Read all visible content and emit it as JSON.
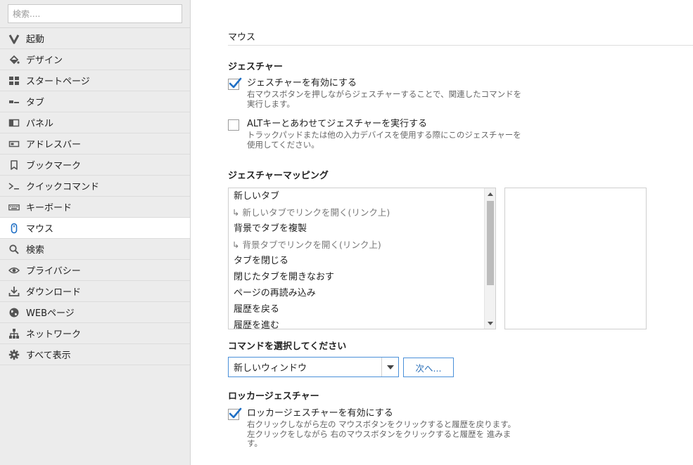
{
  "sidebar": {
    "search_placeholder": "検索....",
    "items": [
      {
        "label": "起動",
        "icon": "vivaldi-logo-icon"
      },
      {
        "label": "デザイン",
        "icon": "paint-bucket-icon"
      },
      {
        "label": "スタートページ",
        "icon": "grid-icon"
      },
      {
        "label": "タブ",
        "icon": "tab-icon"
      },
      {
        "label": "パネル",
        "icon": "panel-icon"
      },
      {
        "label": "アドレスバー",
        "icon": "address-bar-icon"
      },
      {
        "label": "ブックマーク",
        "icon": "bookmark-icon"
      },
      {
        "label": "クイックコマンド",
        "icon": "quick-command-icon"
      },
      {
        "label": "キーボード",
        "icon": "keyboard-icon"
      },
      {
        "label": "マウス",
        "icon": "mouse-icon",
        "active": true
      },
      {
        "label": "検索",
        "icon": "magnifier-icon"
      },
      {
        "label": "プライバシー",
        "icon": "eye-icon"
      },
      {
        "label": "ダウンロード",
        "icon": "download-icon"
      },
      {
        "label": "WEBページ",
        "icon": "globe-icon"
      },
      {
        "label": "ネットワーク",
        "icon": "network-icon"
      },
      {
        "label": "すべて表示",
        "icon": "gear-icon"
      }
    ]
  },
  "main": {
    "title": "マウス",
    "gestures": {
      "heading": "ジェスチャー",
      "enable": {
        "label": "ジェスチャーを有効にする",
        "desc": "右マウスボタンを押しながらジェスチャーすることで、関連したコマンドを実行します。",
        "checked": true
      },
      "alt": {
        "label": "ALTキーとあわせてジェスチャーを実行する",
        "desc": "トラックパッドまたは他の入力デバイスを使用する際にこのジェスチャーを使用してください。",
        "checked": false
      }
    },
    "mapping": {
      "heading": "ジェスチャーマッピング",
      "items": [
        {
          "label": "新しいタブ",
          "sub": false
        },
        {
          "label": "↳ 新しいタブでリンクを開く(リンク上)",
          "sub": true
        },
        {
          "label": "背景でタブを複製",
          "sub": false
        },
        {
          "label": "↳ 背景タブでリンクを開く(リンク上)",
          "sub": true
        },
        {
          "label": "タブを閉じる",
          "sub": false
        },
        {
          "label": "閉じたタブを開きなおす",
          "sub": false
        },
        {
          "label": "ページの再読み込み",
          "sub": false
        },
        {
          "label": "履歴を戻る",
          "sub": false
        },
        {
          "label": "履歴を進む",
          "sub": false
        }
      ]
    },
    "command": {
      "heading": "コマンドを選択してください",
      "selected": "新しいウィンドウ",
      "next_label": "次へ..."
    },
    "rocker": {
      "heading": "ロッカージェスチャー",
      "enable": {
        "label": "ロッカージェスチャーを有効にする",
        "desc": "右クリックしながら左の マウスボタンをクリックすると履歴を戻ります。左クリックをしながら 右のマウスボタンをクリックすると履歴を 進みます。",
        "checked": true
      }
    }
  },
  "colors": {
    "accent": "#4a90d9",
    "check": "#1f6fc5",
    "sidebar_bg": "#ececec"
  }
}
